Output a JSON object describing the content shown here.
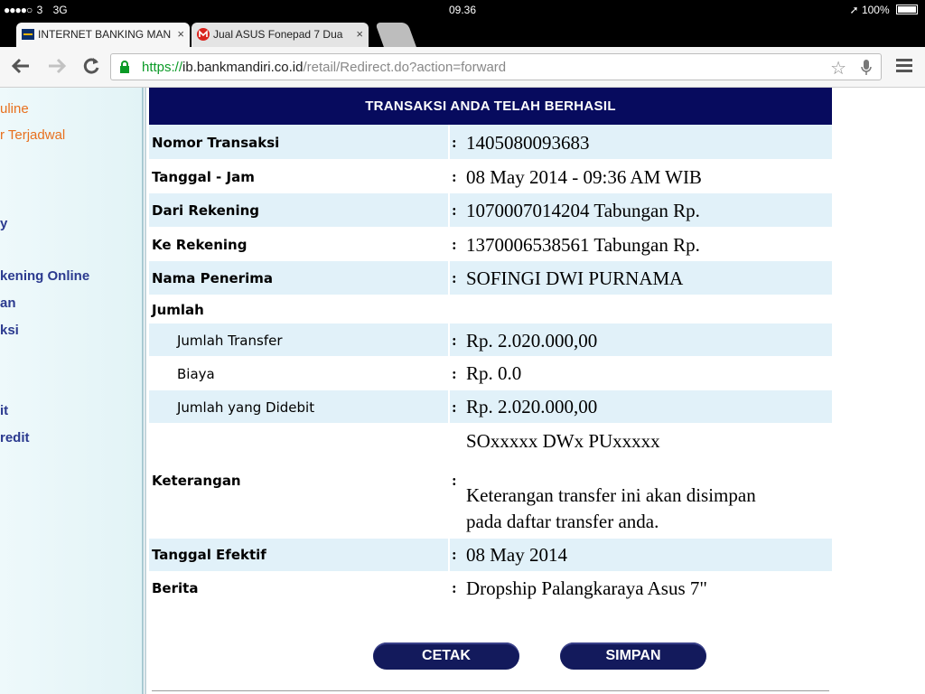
{
  "status_bar": {
    "carrier_dots": "●●●●○",
    "carrier": "3",
    "network": "3G",
    "time": "09.36",
    "battery": "100%"
  },
  "tabs": [
    {
      "title": "INTERNET BANKING MAN",
      "close": "×"
    },
    {
      "title": "Jual ASUS Fonepad 7 Dua",
      "close": "×"
    }
  ],
  "toolbar": {
    "url_scheme": "https://",
    "url_host": "ib.bankmandiri.co.id",
    "url_path": "/retail/Redirect.do?action=forward"
  },
  "sidebar": {
    "items": [
      "uline",
      "r Terjadwal",
      "y",
      "kening Online",
      "an",
      "ksi",
      "it",
      "redit"
    ]
  },
  "panel": {
    "header": "TRANSAKSI ANDA TELAH BERHASIL",
    "nomor_label": "Nomor Transaksi",
    "nomor_value": "1405080093683",
    "tanggal_label": "Tanggal - Jam",
    "tanggal_value": "08 May 2014 - 09:36 AM WIB",
    "dari_label": "Dari Rekening",
    "dari_value": "1070007014204 Tabungan  Rp.",
    "ke_label": "Ke Rekening",
    "ke_value": "1370006538561 Tabungan Rp.",
    "nama_label": "Nama Penerima",
    "nama_value": "SOFINGI DWI PURNAMA",
    "jumlah_label": "Jumlah",
    "transfer_label": "Jumlah Transfer",
    "transfer_value": "Rp. 2.020.000,00",
    "biaya_label": "Biaya",
    "biaya_value": "Rp. 0.0",
    "didebit_label": "Jumlah yang Didebit",
    "didebit_value": "Rp. 2.020.000,00",
    "keterangan_label": "Keterangan",
    "keterangan_value": "SOxxxxx DWx PUxxxxx",
    "keterangan_note1": "Keterangan transfer ini akan disimpan",
    "keterangan_note2": "pada daftar transfer anda.",
    "efektif_label": "Tanggal Efektif",
    "efektif_value": "08 May 2014",
    "berita_label": "Berita",
    "berita_value": "Dropship Palangkaraya Asus 7\"",
    "colon": ":"
  },
  "buttons": {
    "cetak": "CETAK",
    "simpan": "SIMPAN"
  }
}
